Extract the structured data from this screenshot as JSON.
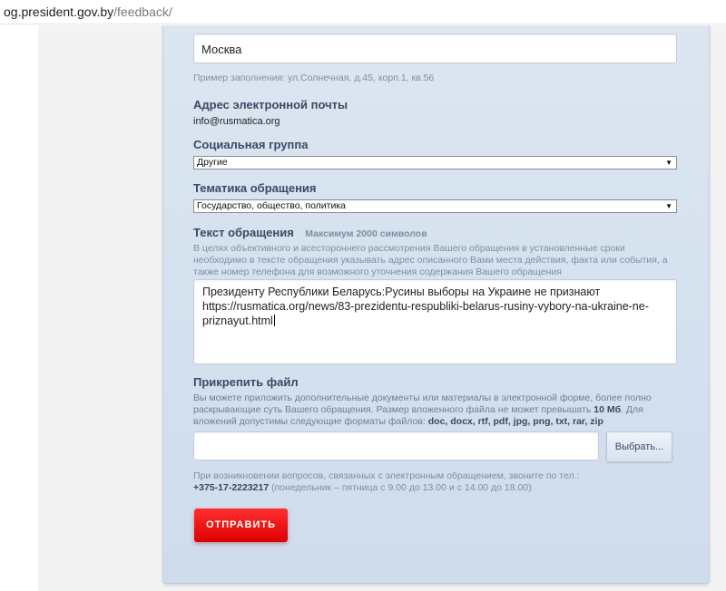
{
  "browser": {
    "url_host": "og.president.gov.by",
    "url_path": "/feedback/"
  },
  "form": {
    "address": {
      "value": "Москва",
      "hint": "Пример заполнения: ул.Солнечная, д.45, корп.1, кв.56"
    },
    "email": {
      "label": "Адрес электронной почты",
      "value": "info@rusmatica.org"
    },
    "social_group": {
      "label": "Социальная группа",
      "selected": "Другие"
    },
    "topic": {
      "label": "Тематика обращения",
      "selected": "Государство, общество, политика"
    },
    "message": {
      "label": "Текст обращения",
      "max_note": "Максимум 2000 символов",
      "hint_lines": [
        "В целях объективного и всестороннего рассмотрения Вашего обращения в установленные сроки",
        "необходимо в тексте обращения указывать адрес описанного Вами места действия, факта или события, а",
        "также номер телефона для возможного уточнения содержания Вашего обращения"
      ],
      "lines": [
        "Президенту Республики Беларусь:Русины выборы на Украине не признают",
        "https://rusmatica.org/news/83-prezidentu-respubliki-belarus-rusiny-vybory-na-ukraine-ne-",
        "priznayut.html"
      ]
    },
    "attach": {
      "label": "Прикрепить файл",
      "hint_line1": "Вы можете приложить дополнительные документы или материалы в электронной форме, более полно",
      "hint_line2_pre": "раскрывающие суть Вашего обращения. Размер вложенного файла не может превышать ",
      "max_size": "10 Мб",
      "hint_line2_post": ". Для",
      "hint_line3_pre": "вложений допустимы следующие форматы файлов: ",
      "formats": "doc, docx, rtf, pdf, jpg, png, txt, rar, zip",
      "file_value": "",
      "choose_label": "Выбрать..."
    },
    "contact": {
      "line1": "При возникновении вопросов, связанных с электронным обращением, звоните по тел.:",
      "phone": "+375-17-2223217",
      "hours": " (понедельник – пятница с 9.00 до 13.00 и с 14.00 до 18.00)"
    },
    "submit_label": "ОТПРАВИТЬ"
  }
}
